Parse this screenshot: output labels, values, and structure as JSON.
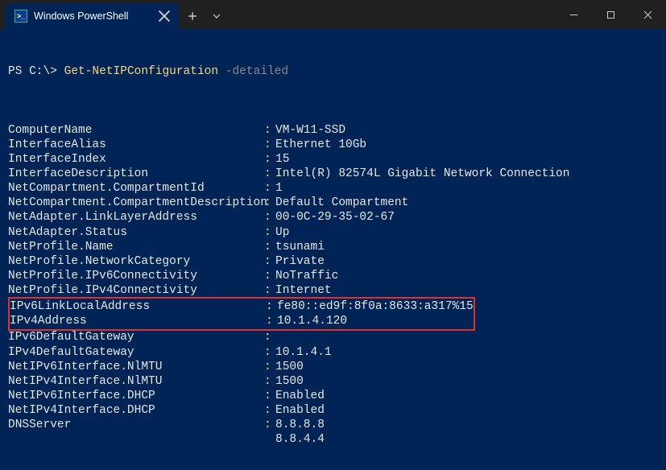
{
  "window": {
    "tab_title": "Windows PowerShell"
  },
  "prompt": {
    "ps": "PS C:\\>",
    "command": "Get-NetIPConfiguration",
    "param": "-detailed"
  },
  "rows": [
    {
      "key": "ComputerName",
      "sep": ":",
      "val": "VM-W11-SSD"
    },
    {
      "key": "InterfaceAlias",
      "sep": ":",
      "val": "Ethernet 10Gb"
    },
    {
      "key": "InterfaceIndex",
      "sep": ":",
      "val": "15"
    },
    {
      "key": "InterfaceDescription",
      "sep": ":",
      "val": "Intel(R) 82574L Gigabit Network Connection"
    },
    {
      "key": "NetCompartment.CompartmentId",
      "sep": ":",
      "val": "1"
    },
    {
      "key": "NetCompartment.CompartmentDescription",
      "sep": ":",
      "val": "Default Compartment"
    },
    {
      "key": "NetAdapter.LinkLayerAddress",
      "sep": ":",
      "val": "00-0C-29-35-02-67"
    },
    {
      "key": "NetAdapter.Status",
      "sep": ":",
      "val": "Up"
    },
    {
      "key": "NetProfile.Name",
      "sep": ":",
      "val": "tsunami"
    },
    {
      "key": "NetProfile.NetworkCategory",
      "sep": ":",
      "val": "Private"
    },
    {
      "key": "NetProfile.IPv6Connectivity",
      "sep": ":",
      "val": "NoTraffic"
    },
    {
      "key": "NetProfile.IPv4Connectivity",
      "sep": ":",
      "val": "Internet"
    },
    {
      "key": "IPv6LinkLocalAddress",
      "sep": ":",
      "val": "fe80::ed9f:8f0a:8633:a317%15",
      "hl": true
    },
    {
      "key": "IPv4Address",
      "sep": ":",
      "val": "10.1.4.120",
      "hl": true
    },
    {
      "key": "IPv6DefaultGateway",
      "sep": ":",
      "val": ""
    },
    {
      "key": "IPv4DefaultGateway",
      "sep": ":",
      "val": "10.1.4.1"
    },
    {
      "key": "NetIPv6Interface.NlMTU",
      "sep": ":",
      "val": "1500"
    },
    {
      "key": "NetIPv4Interface.NlMTU",
      "sep": ":",
      "val": "1500"
    },
    {
      "key": "NetIPv6Interface.DHCP",
      "sep": ":",
      "val": "Enabled"
    },
    {
      "key": "NetIPv4Interface.DHCP",
      "sep": ":",
      "val": "Enabled"
    },
    {
      "key": "DNSServer",
      "sep": ":",
      "val": "8.8.8.8"
    },
    {
      "key": "",
      "sep": "",
      "val": "8.8.4.4",
      "continuation": true
    }
  ]
}
